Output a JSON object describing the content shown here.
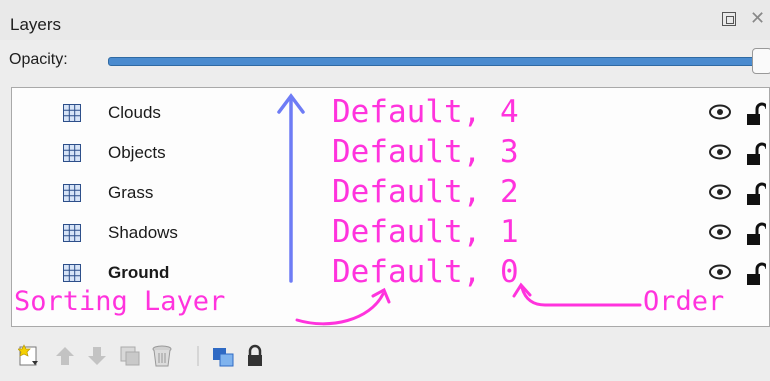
{
  "panel": {
    "title": "Layers"
  },
  "opacity": {
    "label": "Opacity:",
    "value": 1.0
  },
  "layers": [
    {
      "name": "Clouds",
      "sorting": "Default, 4",
      "visible": true,
      "locked": false,
      "bold": false
    },
    {
      "name": "Objects",
      "sorting": "Default, 3",
      "visible": true,
      "locked": false,
      "bold": false
    },
    {
      "name": "Grass",
      "sorting": "Default, 2",
      "visible": true,
      "locked": false,
      "bold": false
    },
    {
      "name": "Shadows",
      "sorting": "Default, 1",
      "visible": true,
      "locked": false,
      "bold": false
    },
    {
      "name": "Ground",
      "sorting": "Default, 0",
      "visible": true,
      "locked": false,
      "bold": true
    }
  ],
  "annotations": {
    "sorting_layer": "Sorting Layer",
    "order": "Order",
    "color": "#ff33dd",
    "arrow_color": "#6e7cf5"
  },
  "icons": {
    "layer": "grid-icon",
    "visibility": "eye-icon",
    "lock": "unlock-icon",
    "toolbar": [
      "new-layer-icon",
      "raise-layer-icon",
      "lower-layer-icon",
      "duplicate-layer-icon",
      "delete-layer-icon",
      "layer-properties-icon",
      "lock-all-icon"
    ]
  },
  "colors": {
    "accent": "#4a8bcf",
    "annotation": "#ff33dd"
  }
}
